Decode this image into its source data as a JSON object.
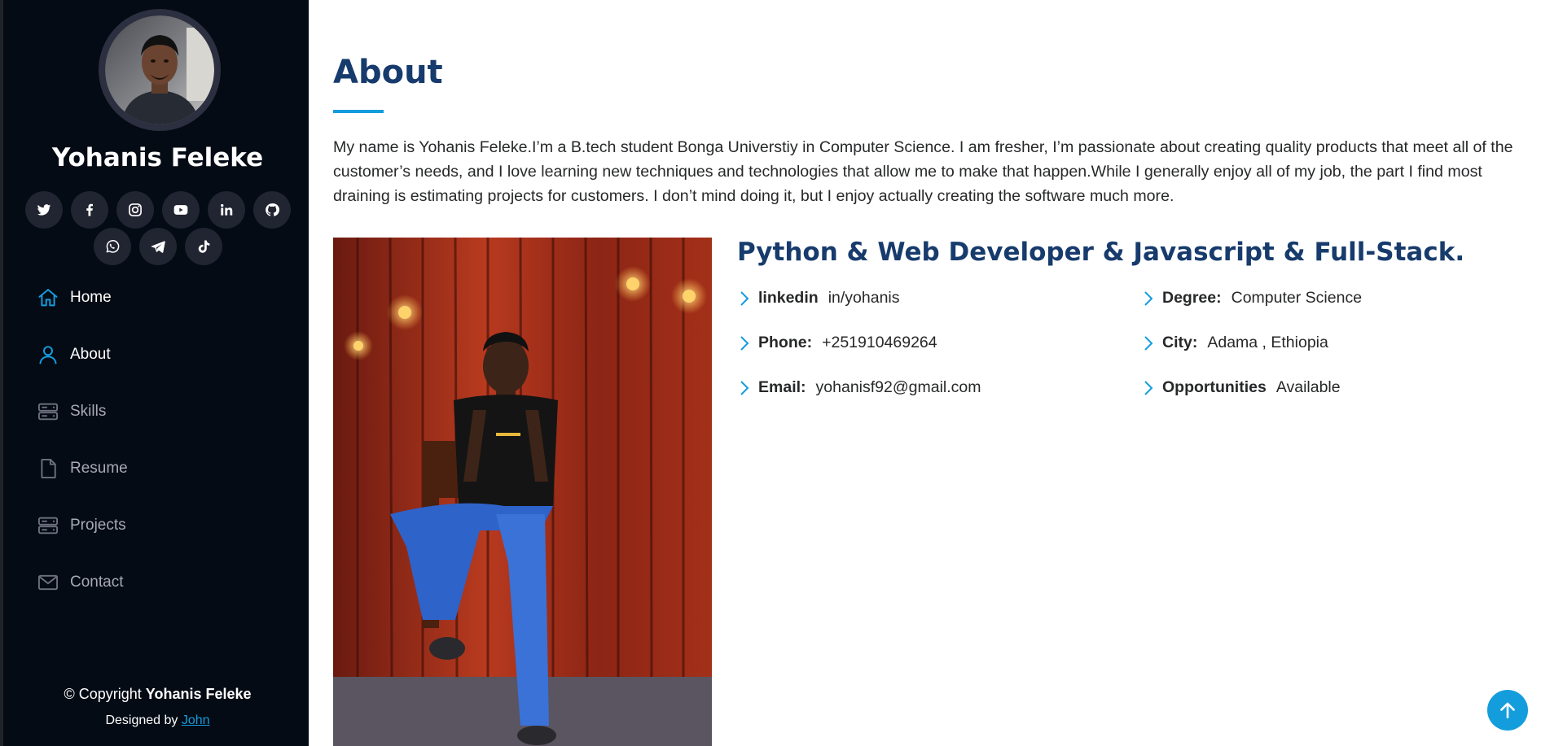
{
  "sidebar": {
    "profile_name": "Yohanis Feleke",
    "social_links": [
      {
        "icon": "twitter-icon"
      },
      {
        "icon": "facebook-icon"
      },
      {
        "icon": "instagram-icon"
      },
      {
        "icon": "youtube-icon"
      },
      {
        "icon": "linkedin-icon"
      },
      {
        "icon": "github-icon"
      },
      {
        "icon": "whatsapp-icon"
      },
      {
        "icon": "telegram-icon"
      },
      {
        "icon": "tiktok-icon"
      }
    ],
    "nav": [
      {
        "label": "Home",
        "icon": "home-icon",
        "active": true
      },
      {
        "label": "About",
        "icon": "person-icon",
        "active": true
      },
      {
        "label": "Skills",
        "icon": "server-icon",
        "active": false
      },
      {
        "label": "Resume",
        "icon": "file-icon",
        "active": false
      },
      {
        "label": "Projects",
        "icon": "server-icon",
        "active": false
      },
      {
        "label": "Contact",
        "icon": "envelope-icon",
        "active": false
      }
    ],
    "footer": {
      "copyright_prefix": "© Copyright",
      "copyright_name": "Yohanis Feleke",
      "designed_by_prefix": "Designed by",
      "designer_link": "John"
    }
  },
  "main": {
    "section_title": "About",
    "about_text": "My name is Yohanis Feleke.I’m a B.tech student Bonga Universtiy in Computer Science. I am fresher, I’m passionate about creating quality products that meet all of the customer’s needs, and I love learning new techniques and technologies that allow me to make that happen.While I generally enjoy all of my job, the part I find most draining is estimating projects for customers. I don’t mind doing it, but I enjoy actually creating the software much more.",
    "role_title": "Python & Web Developer & Javascript & Full-Stack.",
    "info": {
      "linkedin": {
        "key": "linkedin",
        "value": "in/yohanis"
      },
      "phone": {
        "key": "Phone:",
        "value": "+251910469264"
      },
      "email": {
        "key": "Email:",
        "value": "yohanisf92@gmail.com"
      },
      "degree": {
        "key": "Degree:",
        "value": "Computer Science"
      },
      "city": {
        "key": "City:",
        "value": "Adama , Ethiopia"
      },
      "opportunities": {
        "key": "Opportunities",
        "value": "Available"
      }
    }
  },
  "colors": {
    "sidebar_bg": "#040b14",
    "accent": "#149ddd",
    "heading": "#173b6c",
    "social_bg": "#212431",
    "nav_inactive": "#a8a9b4"
  },
  "back_to_top": {
    "icon": "arrow-up-icon"
  }
}
